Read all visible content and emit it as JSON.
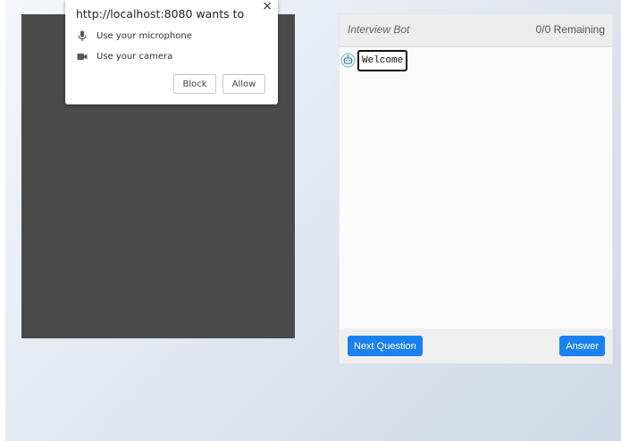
{
  "permission_prompt": {
    "title": "http://localhost:8080 wants to",
    "close_symbol": "×",
    "permissions": [
      {
        "label": "Use your microphone",
        "icon": "microphone-icon"
      },
      {
        "label": "Use your camera",
        "icon": "camera-icon"
      }
    ],
    "block_label": "Block",
    "allow_label": "Allow"
  },
  "chat": {
    "title": "Interview Bot",
    "remaining": "0/0 Remaining",
    "messages": [
      {
        "sender": "bot",
        "text": "Welcome",
        "icon": "bot-avatar-icon"
      }
    ],
    "next_question_label": "Next Question",
    "answer_label": "Answer"
  },
  "colors": {
    "primary_button": "#1a82ee",
    "video_background": "#4a4a4a"
  }
}
